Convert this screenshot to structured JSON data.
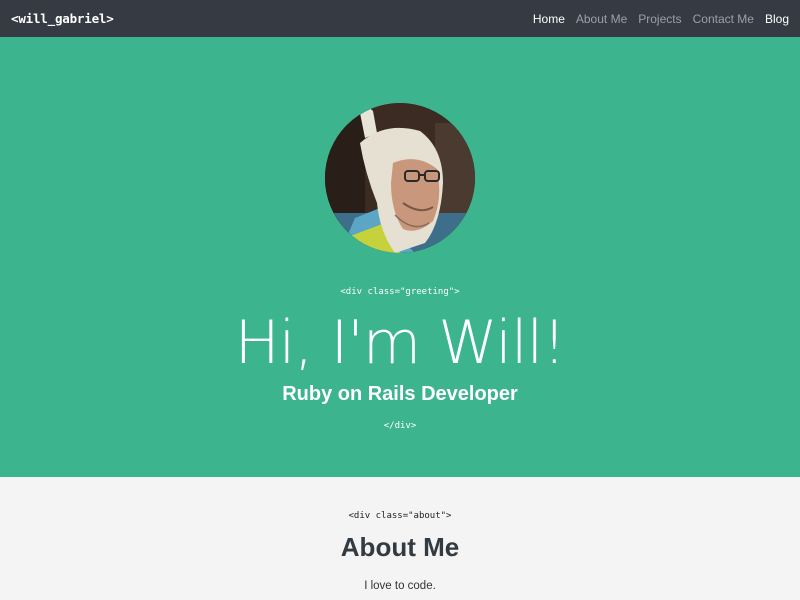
{
  "navbar": {
    "brand": "<will_gabriel>",
    "links": [
      {
        "label": "Home"
      },
      {
        "label": "About Me"
      },
      {
        "label": "Projects"
      },
      {
        "label": "Contact Me"
      },
      {
        "label": "Blog"
      }
    ]
  },
  "hero": {
    "open_tag": "<div class=\"greeting\">",
    "title": "Hi, I'm Will!",
    "subtitle": "Ruby on Rails Developer",
    "close_tag": "</div>"
  },
  "about": {
    "open_tag": "<div class=\"about\">",
    "title": "About Me",
    "text": "I love to code."
  },
  "colors": {
    "navbar": "#353a43",
    "hero": "#3cb48e",
    "about_bg": "#f4f4f4"
  }
}
